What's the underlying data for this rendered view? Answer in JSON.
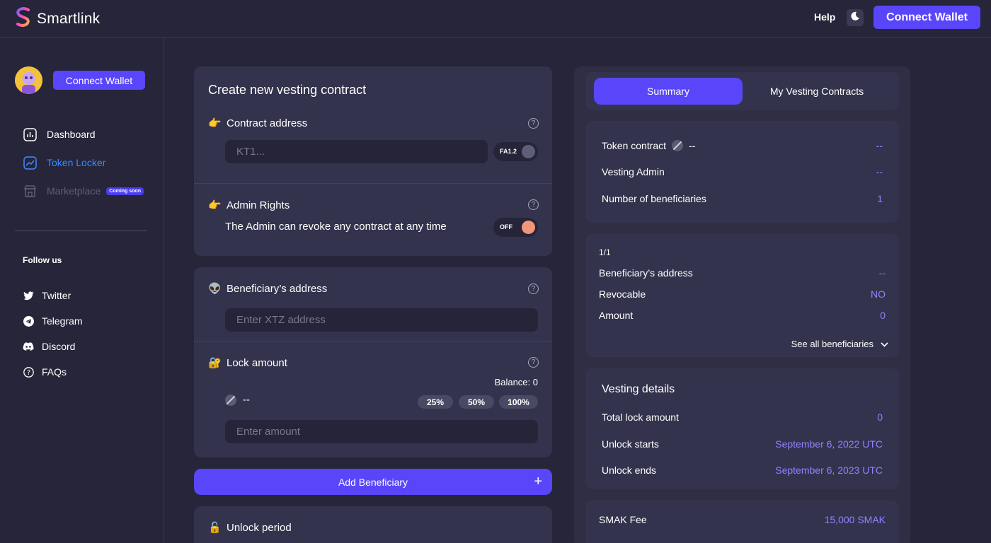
{
  "header": {
    "app_name": "Smartlink",
    "help_label": "Help",
    "connect_wallet_label": "Connect Wallet"
  },
  "sidebar": {
    "connect_wallet_label": "Connect Wallet",
    "nav": [
      {
        "label": "Dashboard"
      },
      {
        "label": "Token Locker"
      },
      {
        "label": "Marketplace",
        "badge": "Coming soon"
      }
    ],
    "follow_label": "Follow us",
    "social": [
      {
        "label": "Twitter"
      },
      {
        "label": "Telegram"
      },
      {
        "label": "Discord"
      },
      {
        "label": "FAQs"
      }
    ]
  },
  "create": {
    "title": "Create new vesting contract",
    "contract_address": {
      "label": "Contract address",
      "placeholder": "KT1...",
      "standard_toggle": "FA1.2"
    },
    "admin_rights": {
      "label": "Admin Rights",
      "description": "The Admin can revoke any contract at any time",
      "toggle_label": "OFF"
    }
  },
  "beneficiary": {
    "address_label": "Beneficiary’s address",
    "address_placeholder": "Enter XTZ address",
    "lock_amount_label": "Lock amount",
    "balance_text": "Balance: 0",
    "token_value": "--",
    "percent_buttons": [
      "25%",
      "50%",
      "100%"
    ],
    "amount_placeholder": "Enter amount"
  },
  "add_beneficiary_label": "Add Beneficiary",
  "add_beneficiary_symbol": "+",
  "unlock_period_label": "Unlock period",
  "summary": {
    "tabs": [
      "Summary",
      "My Vesting Contracts"
    ],
    "token_contract": {
      "label": "Token contract",
      "inline_value": "--",
      "value": "--"
    },
    "vesting_admin": {
      "label": "Vesting Admin",
      "value": "--"
    },
    "num_beneficiaries": {
      "label": "Number of beneficiaries",
      "value": "1"
    },
    "beneficiary_page": "1/1",
    "beneficiary_address": {
      "label": "Beneficiary’s address",
      "value": "--"
    },
    "revocable": {
      "label": "Revocable",
      "value": "NO"
    },
    "amount": {
      "label": "Amount",
      "value": "0"
    },
    "see_all_label": "See all beneficiaries",
    "vesting_details_title": "Vesting details",
    "total_lock": {
      "label": "Total lock amount",
      "value": "0"
    },
    "unlock_starts": {
      "label": "Unlock starts",
      "value": "September 6, 2022 UTC"
    },
    "unlock_ends": {
      "label": "Unlock ends",
      "value": "September 6, 2023 UTC"
    },
    "smak_fee": {
      "label": "SMAK Fee",
      "value": "15,000 SMAK"
    }
  },
  "colors": {
    "accent": "#5a46fa",
    "background": "#262539",
    "card": "#34334d",
    "value_text": "#8d84ff",
    "active_nav": "#3d8bff",
    "toggle_knob_off": "#f1967a"
  }
}
